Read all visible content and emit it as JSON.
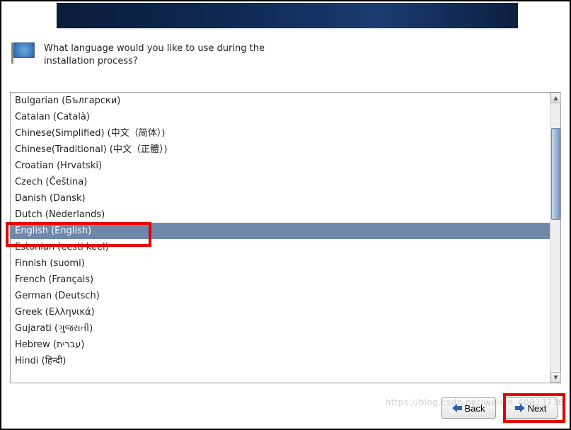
{
  "prompt": "What language would you like to use during the installation process?",
  "languages": [
    "Bulgarian (Български)",
    "Catalan (Català)",
    "Chinese(Simplified) (中文（简体）)",
    "Chinese(Traditional) (中文（正體）)",
    "Croatian (Hrvatski)",
    "Czech (Čeština)",
    "Danish (Dansk)",
    "Dutch (Nederlands)",
    "English (English)",
    "Estonian (eesti keel)",
    "Finnish (suomi)",
    "French (Français)",
    "German (Deutsch)",
    "Greek (Ελληνικά)",
    "Gujarati (ગુજરાતી)",
    "Hebrew (עברית)",
    "Hindi (हिन्दी)"
  ],
  "selected_index": 8,
  "buttons": {
    "back": "Back",
    "next": "Next"
  },
  "watermark": "https://blog.csdn.net/weixin_40813738"
}
